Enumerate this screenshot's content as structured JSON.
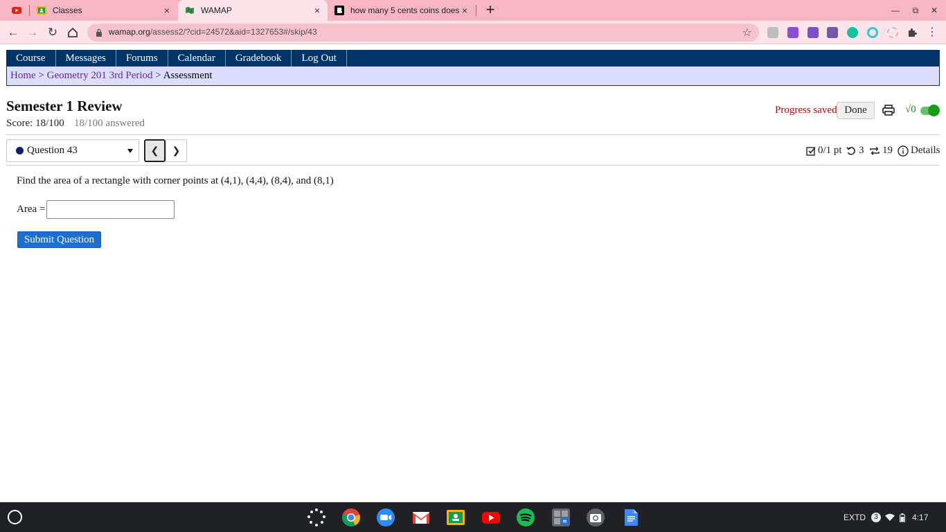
{
  "browser": {
    "tabs": [
      {
        "title": "",
        "favicon": "youtube-icon"
      },
      {
        "title": "Classes",
        "favicon": "google-classroom-icon"
      },
      {
        "title": "WAMAP",
        "favicon": "wamap-icon"
      },
      {
        "title": "how many 5 cents coins does he",
        "favicon": "brainly-icon"
      }
    ],
    "url_host": "wamap.org",
    "url_path": "/assess2/?cid=24572&aid=1327653#/skip/43",
    "colors": {
      "tabstrip": "#f6b6c3",
      "toolbar": "#fde3ea"
    }
  },
  "nav": {
    "items": [
      "Course",
      "Messages",
      "Forums",
      "Calendar",
      "Gradebook",
      "Log Out"
    ]
  },
  "breadcrumb": {
    "home": "Home",
    "course": "Geometry 201 3rd Period",
    "current": "Assessment",
    "sep": ">"
  },
  "assessment": {
    "title": "Semester 1 Review",
    "score": "Score: 18/100",
    "answered": "18/100 answered",
    "progress_saved": "Progress saved",
    "done_label": "Done",
    "math_toggle_label": "√0"
  },
  "question": {
    "selector_label": "Question 43",
    "points": "0/1 pt",
    "retries": "3",
    "attempts": "19",
    "details": "Details",
    "text": "Find the area of a rectangle with corner points at (4,1), (4,4), (8,4), and (8,1)",
    "answer_label": "Area =",
    "answer_value": "",
    "submit_label": "Submit Question"
  },
  "shelf": {
    "apps": [
      "launcher-icon",
      "chrome-icon",
      "zoom-icon",
      "gmail-icon",
      "classroom-icon",
      "youtube-icon",
      "spotify-icon",
      "calculator-icon",
      "camera-icon",
      "docs-icon"
    ],
    "display": "EXTD",
    "notifications": "3",
    "time": "4:17"
  }
}
